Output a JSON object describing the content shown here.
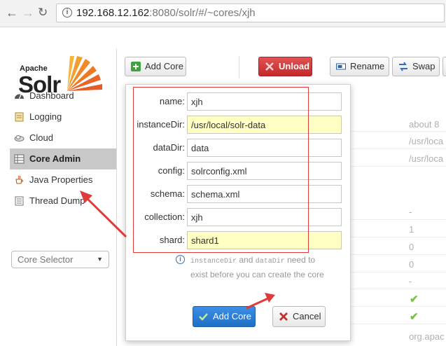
{
  "browser": {
    "url_host": "192.168.12.162",
    "url_rest": ":8080/solr/#/~cores/xjh"
  },
  "logo": {
    "apache": "Apache",
    "solr": "Solr"
  },
  "sidebar": {
    "items": [
      {
        "label": "Dashboard",
        "icon": "dashboard-icon",
        "active": false
      },
      {
        "label": "Logging",
        "icon": "logging-icon",
        "active": false
      },
      {
        "label": "Cloud",
        "icon": "cloud-icon",
        "active": false
      },
      {
        "label": "Core Admin",
        "icon": "core-admin-icon",
        "active": true
      },
      {
        "label": "Java Properties",
        "icon": "java-icon",
        "active": false
      },
      {
        "label": "Thread Dump",
        "icon": "thread-dump-icon",
        "active": false
      }
    ],
    "core_selector": "Core Selector"
  },
  "toolbar": {
    "add_core": "Add Core",
    "unload": "Unload",
    "rename": "Rename",
    "swap": "Swap"
  },
  "background_values": {
    "v1": "about 8",
    "v2": "/usr/loca",
    "v3": "/usr/loca",
    "v4": "-",
    "v5": "1",
    "v6": "0",
    "v7": "0",
    "v8": "-",
    "v9": "org.apac"
  },
  "dialog": {
    "fields": [
      {
        "label": "name:",
        "value": "xjh",
        "highlight": false
      },
      {
        "label": "instanceDir:",
        "value": "/usr/local/solr-data",
        "highlight": true
      },
      {
        "label": "dataDir:",
        "value": "data",
        "highlight": false
      },
      {
        "label": "config:",
        "value": "solrconfig.xml",
        "highlight": false
      },
      {
        "label": "schema:",
        "value": "schema.xml",
        "highlight": false
      },
      {
        "label": "collection:",
        "value": "xjh",
        "highlight": false
      },
      {
        "label": "shard:",
        "value": "shard1",
        "highlight": true
      }
    ],
    "hint_code1": "instanceDir",
    "hint_and": " and ",
    "hint_code2": "dataDir",
    "hint_text": " need to exist before you can create the core",
    "submit": "Add Core",
    "cancel": "Cancel"
  },
  "colors": {
    "unload_red": "#c52a2a",
    "submit_blue": "#1e6fc4",
    "annotation_red": "#e03b3b",
    "highlight_yellow": "#ffffc4"
  }
}
